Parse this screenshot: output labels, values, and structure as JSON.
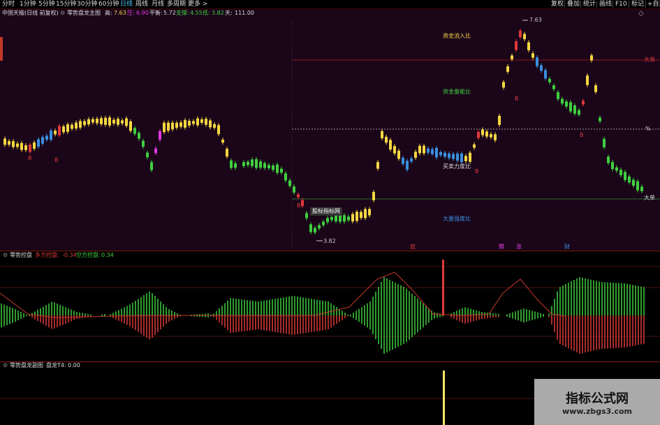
{
  "toolbar": {
    "periods": [
      {
        "label": "分时",
        "active": false
      },
      {
        "label": "1分钟",
        "active": false
      },
      {
        "label": "5分钟",
        "active": false
      },
      {
        "label": "15分钟",
        "active": false
      },
      {
        "label": "30分钟",
        "active": false
      },
      {
        "label": "60分钟",
        "active": false
      },
      {
        "label": "日线",
        "active": true
      },
      {
        "label": "周线",
        "active": false
      },
      {
        "label": "月线",
        "active": false
      },
      {
        "label": "多周期",
        "active": false
      },
      {
        "label": "更多 >",
        "active": false
      }
    ],
    "right_items": [
      "复权",
      "叠加",
      "统计",
      "画线",
      "F10",
      "标记",
      "+自选"
    ]
  },
  "main": {
    "stock": "中国天楹(日线 前复权)",
    "indicator": "零势盘龙主图",
    "high_label": "高:",
    "high_value": "7.63",
    "pressure_label": "压:",
    "pressure_value": "6.90",
    "balance_label": "平衡:",
    "balance_value": "5.72",
    "support_label": "支撑:",
    "support_value": "4.55",
    "low_label": "低:",
    "low_value": "3.82",
    "sky_label": "天:",
    "sky_value": "111.00",
    "annot_capital_inflow": "资金流入比",
    "annot_capital_energy": "资金量能比",
    "annot_buy_sell": "买卖力度比",
    "annot_big_strength": "大量强度比",
    "marker_big_order_1": "大单",
    "marker_pct": "%",
    "marker_big_order_2": "大单",
    "peak_label": "7.63",
    "trough_label": "3.82",
    "tooltip": "股标指标网",
    "bottom_markers": [
      "底",
      "腾",
      "涨",
      "财"
    ],
    "b_markers": [
      "B",
      "B",
      "B",
      "B",
      "B",
      "B"
    ],
    "colors": {
      "bg": "#1a0519",
      "yellow": "#f5d742",
      "green": "#3fd13f",
      "blue": "#3a8fe0",
      "red": "#e03a3a",
      "magenta": "#e03ae0"
    }
  },
  "mid": {
    "indicator": "零势控盘",
    "long_label": "多方控盘:",
    "long_value": "-0.34",
    "short_label": "空方控盘:",
    "short_value": "0.34"
  },
  "bottom": {
    "indicator": "零势盘龙副图",
    "t4_label": "盘龙T4:",
    "t4_value": "0.00"
  },
  "watermark": {
    "title": "指标公式网",
    "url": "www.zbgs3.com"
  }
}
